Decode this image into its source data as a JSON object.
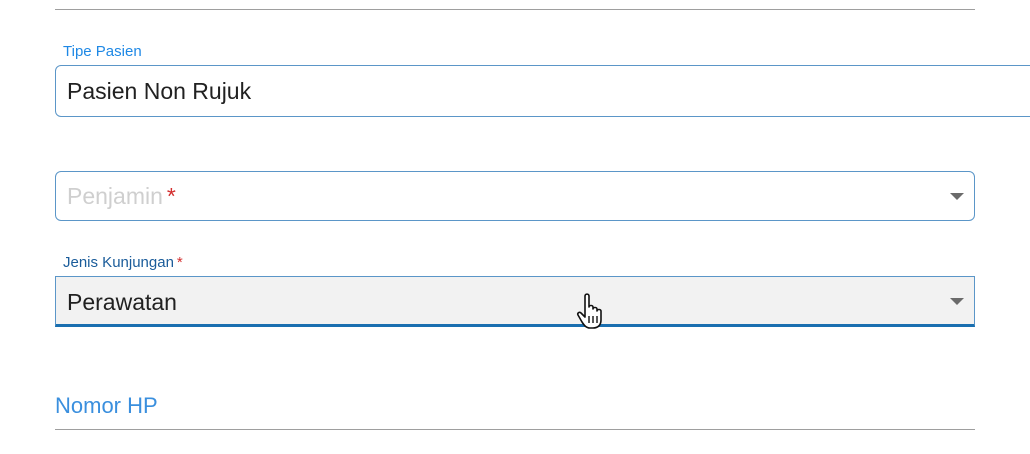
{
  "tipe_pasien": {
    "label": "Tipe Pasien",
    "value": "Pasien Non Rujuk"
  },
  "penjamin": {
    "placeholder": "Penjamin",
    "required_mark": "*"
  },
  "jenis_kunjungan": {
    "label": "Jenis Kunjungan",
    "required_mark": "*",
    "value": "Perawatan"
  },
  "nomor_hp": {
    "label": "Nomor HP"
  },
  "colors": {
    "accent": "#1e88e5",
    "border": "#5b96c8",
    "required": "#d32f2f",
    "active_underline": "#1a6fb0"
  },
  "icons": {
    "dropdown": "chevron-down-icon",
    "cursor": "hand-pointer-icon"
  }
}
